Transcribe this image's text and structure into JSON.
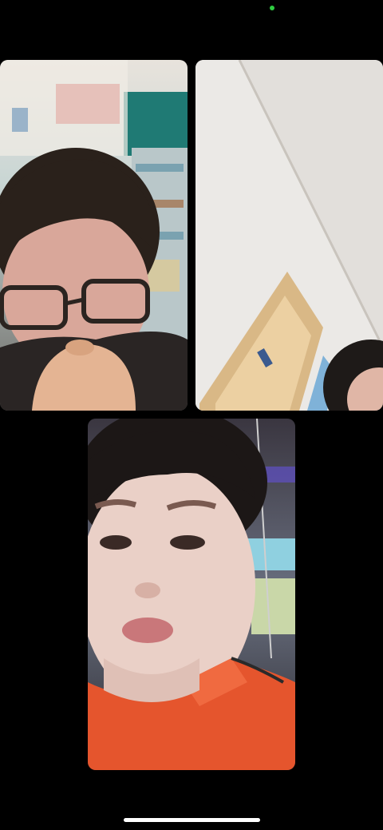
{
  "call": {
    "status_indicator": "camera-active",
    "status_color": "#2ecc40",
    "participants": [
      {
        "tile": "video-tile-1",
        "content": "participant-video"
      },
      {
        "tile": "video-tile-2",
        "content": "participant-video"
      },
      {
        "tile": "video-tile-3",
        "content": "participant-video"
      }
    ]
  }
}
